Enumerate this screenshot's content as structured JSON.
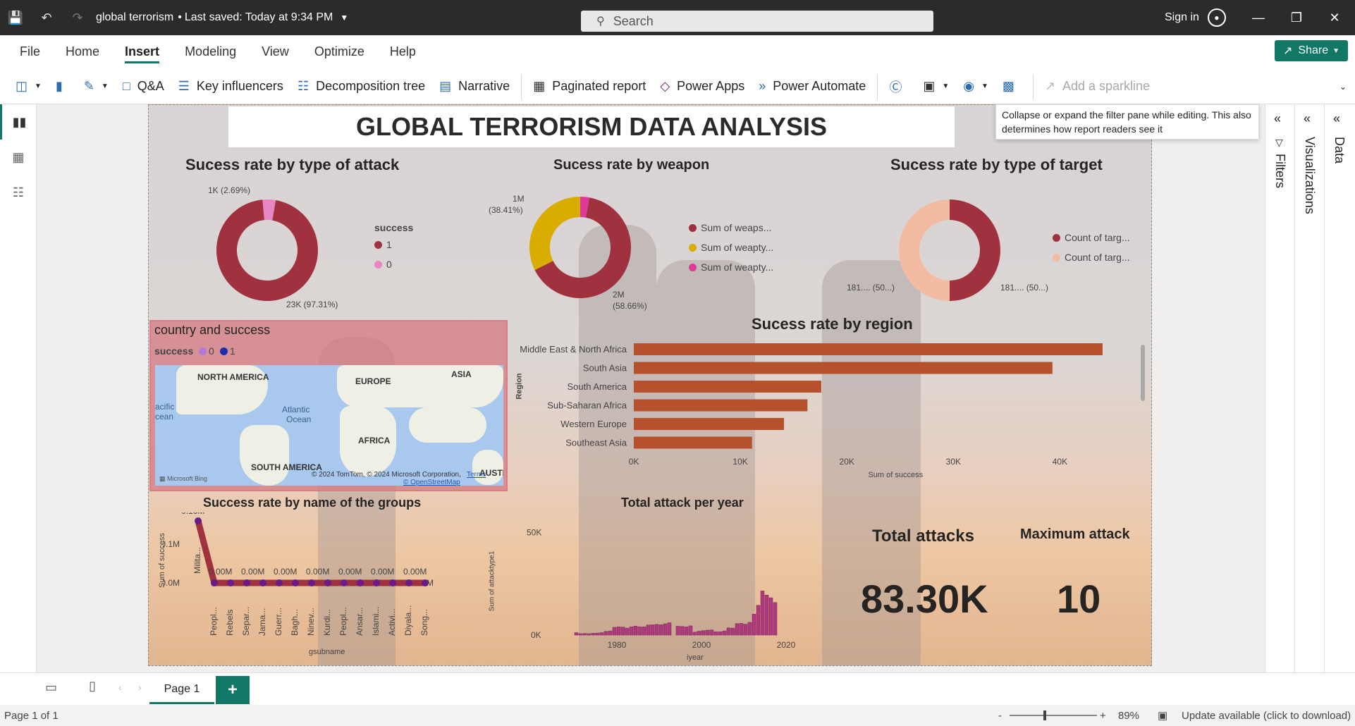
{
  "titlebar": {
    "doc_title": "global terrorism",
    "saved": "Last saved: Today at 9:34 PM",
    "search_placeholder": "Search",
    "signin": "Sign in"
  },
  "menu": [
    "File",
    "Home",
    "Insert",
    "Modeling",
    "View",
    "Optimize",
    "Help"
  ],
  "share_label": "Share",
  "ribbon": {
    "qa": "Q&A",
    "key_influencers": "Key influencers",
    "decomposition_tree": "Decomposition tree",
    "narrative": "Narrative",
    "paginated_report": "Paginated report",
    "power_apps": "Power Apps",
    "power_automate": "Power Automate",
    "add_sparkline": "Add a sparkline"
  },
  "report": {
    "title": "GLOBAL TERRORISM DATA ANALYSIS",
    "attack": {
      "title": "Sucess rate by type of attack",
      "legend_title": "success",
      "legend": [
        "1",
        "0"
      ],
      "lbl_small": "1K (2.69%)",
      "lbl_big": "23K (97.31%)"
    },
    "weapon": {
      "title": "Sucess rate by weapon",
      "legend": [
        "Sum of weaps...",
        "Sum of weapty...",
        "Sum of weapty..."
      ],
      "lbl_a1": "1M",
      "lbl_a2": "(38.41%)",
      "lbl_b1": "2M",
      "lbl_b2": "(58.66%)"
    },
    "target": {
      "title": "Sucess rate by type of target",
      "legend": [
        "Count of targ...",
        "Count of targ..."
      ],
      "lbl_left": "181.... (50...)",
      "lbl_right": "181.... (50...)"
    },
    "map": {
      "title": "country and success",
      "legend_title": "success",
      "legend": [
        "0",
        "1"
      ],
      "labels": [
        "NORTH AMERICA",
        "EUROPE",
        "ASIA",
        "Atlantic",
        "Ocean",
        "acific",
        "cean",
        "AFRICA",
        "SOUTH AMERICA",
        "AUSTR"
      ],
      "copyright": "© 2024 TomTom, © 2024 Microsoft Corporation,",
      "osm": "© OpenStreetMap",
      "terms": "Terms",
      "bing": "Microsoft Bing"
    },
    "region": {
      "title": "Sucess rate by region",
      "ylabel": "Region",
      "xlabel": "Sum of success",
      "ticks": [
        "0K",
        "10K",
        "20K",
        "30K",
        "40K"
      ]
    },
    "groups": {
      "title": "Success rate by name of the groups",
      "ylabel": "Sum of success",
      "xlabel": "gsubname",
      "peak_label": "0.16M",
      "zero_label": "0.00M",
      "end_label": "M",
      "yticks": [
        "0.2M",
        "0.1M",
        "0.0M"
      ]
    },
    "yearly": {
      "title": "Total attack per year",
      "ylabel": "Sum of attacktype1",
      "xlabel": "iyear",
      "yticks": [
        "50K",
        "0K"
      ],
      "xticks": [
        "1980",
        "2000",
        "2020"
      ]
    },
    "kpi_total": {
      "label": "Total attacks",
      "value": "83.30K"
    },
    "kpi_max": {
      "label": "Maximum attack",
      "value": "10"
    }
  },
  "tooltip": "Collapse or expand the filter pane while editing. This also determines how report readers see it",
  "panes": {
    "filters": "Filters",
    "visualizations": "Visualizations",
    "data": "Data"
  },
  "bottom": {
    "page_tab": "Page 1",
    "add": "+"
  },
  "status": {
    "page": "Page 1 of 1",
    "zoom": "89%",
    "update": "Update available (click to download)"
  },
  "colors": {
    "maroon": "#a0313f",
    "pink": "#e886c4",
    "gold": "#d9ad00",
    "magenta": "#e0399b",
    "peach": "#f3bca2",
    "bar": "#b5512c",
    "accent": "#117865"
  },
  "chart_data": [
    {
      "type": "pie",
      "title": "Sucess rate by type of attack",
      "categories": [
        "1",
        "0"
      ],
      "values": [
        23000,
        1000
      ],
      "percent": [
        97.31,
        2.69
      ]
    },
    {
      "type": "pie",
      "title": "Sucess rate by weapon",
      "categories": [
        "Sum of weaps...",
        "Sum of weapty...",
        "Sum of weapty..."
      ],
      "values": [
        2000000,
        1000000,
        90000
      ],
      "percent": [
        58.66,
        38.41,
        2.93
      ]
    },
    {
      "type": "pie",
      "title": "Sucess rate by type of target",
      "categories": [
        "Count of targ...",
        "Count of targ..."
      ],
      "values": [
        181,
        181
      ],
      "percent": [
        50,
        50
      ]
    },
    {
      "type": "bar",
      "title": "Sucess rate by region",
      "orientation": "horizontal",
      "categories": [
        "Middle East & North Africa",
        "South Asia",
        "South America",
        "Sub-Saharan Africa",
        "Western Europe",
        "Southeast Asia"
      ],
      "values": [
        44000,
        39300,
        17600,
        16300,
        14100,
        11100
      ],
      "xlabel": "Sum of success",
      "ylabel": "Region",
      "xlim": [
        0,
        45000
      ]
    },
    {
      "type": "line",
      "title": "Success rate by name of the groups",
      "categories": [
        "Milita...",
        "Peopl...",
        "Rebels",
        "Separ...",
        "Jama...",
        "Guerr...",
        "Bagh...",
        "Ninev...",
        "Kurdi...",
        "Peopl...",
        "Ansar...",
        "Islami...",
        "Activi...",
        "Diyala...",
        "Song..."
      ],
      "values": [
        0.16,
        0,
        0,
        0,
        0,
        0,
        0,
        0,
        0,
        0,
        0,
        0,
        0,
        0,
        0
      ],
      "ylabel": "Sum of success",
      "xlabel": "gsubname",
      "ylim": [
        0,
        0.2
      ],
      "unit": "M"
    },
    {
      "type": "bar",
      "title": "Total attack per year",
      "x": [
        1970,
        1971,
        1972,
        1973,
        1974,
        1975,
        1976,
        1977,
        1978,
        1979,
        1980,
        1981,
        1982,
        1983,
        1984,
        1985,
        1986,
        1987,
        1988,
        1989,
        1990,
        1991,
        1992,
        1994,
        1995,
        1996,
        1997,
        1998,
        1999,
        2000,
        2001,
        2002,
        2003,
        2004,
        2005,
        2006,
        2007,
        2008,
        2009,
        2010,
        2011,
        2012,
        2013,
        2014,
        2015,
        2016,
        2017
      ],
      "values": [
        1200,
        700,
        800,
        700,
        900,
        1000,
        1200,
        1800,
        2000,
        3800,
        4000,
        3900,
        3400,
        4000,
        4400,
        4000,
        4000,
        4900,
        5000,
        5200,
        5000,
        5500,
        6000,
        4300,
        4200,
        4000,
        4500,
        1400,
        1900,
        2200,
        2400,
        2500,
        1600,
        1600,
        2000,
        3500,
        3400,
        5600,
        5700,
        5300,
        6200,
        10200,
        14500,
        21500,
        19500,
        18200,
        15900
      ],
      "xlabel": "iyear",
      "ylabel": "Sum of attacktype1",
      "ylim": [
        0,
        55000
      ]
    }
  ]
}
